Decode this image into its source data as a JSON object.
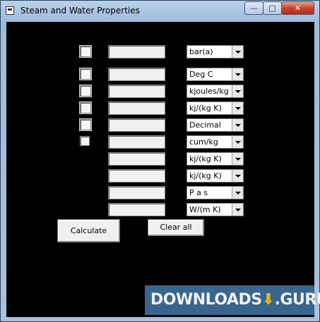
{
  "window": {
    "title": "Steam and Water Properties",
    "controls": {
      "minimize": "—",
      "maximize": "□",
      "close": "✕"
    }
  },
  "rows": [
    {
      "checkbox": true,
      "unit": "bar(a)"
    },
    {
      "checkbox": true,
      "unit": "Deg C"
    },
    {
      "checkbox": true,
      "unit": "kjoules/kg"
    },
    {
      "checkbox": true,
      "unit": "kj/(kg K)"
    },
    {
      "checkbox": true,
      "unit": "Decimal"
    },
    {
      "checkbox": true,
      "unit": "cum/kg"
    },
    {
      "checkbox": false,
      "unit": "kj/(kg K)"
    },
    {
      "checkbox": false,
      "unit": "kj/(kg K)"
    },
    {
      "checkbox": false,
      "unit": "P a s"
    },
    {
      "checkbox": false,
      "unit": "W/(m K)"
    }
  ],
  "buttons": {
    "calculate": "Calculate",
    "clear_all": "Clear all"
  },
  "watermark": {
    "left": "DOWNLOADS",
    "arrow": "⬇",
    "right": ".GURU"
  }
}
